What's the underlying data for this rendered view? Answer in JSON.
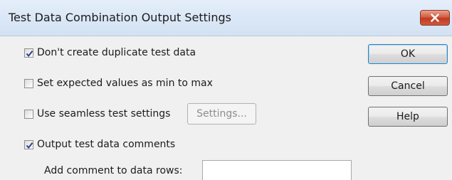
{
  "window": {
    "title": "Test Data Combination Output Settings",
    "close_icon": "close-icon"
  },
  "options": [
    {
      "label": "Don't create duplicate test data",
      "checked": true
    },
    {
      "label": "Set expected values as min to max",
      "checked": false
    },
    {
      "label": "Use seamless test settings",
      "checked": false
    },
    {
      "label": "Output test data comments",
      "checked": true
    }
  ],
  "settings_button": {
    "label": "Settings...",
    "enabled": false
  },
  "buttons": {
    "ok": "OK",
    "cancel": "Cancel",
    "help": "Help"
  },
  "comment_field": {
    "label": "Add comment to data rows:",
    "value": ""
  },
  "colors": {
    "title_bar": "#dbe8f7",
    "dialog_bg": "#f0f0f0",
    "close_button": "#c7472a",
    "default_button_border": "#3c7fb1"
  }
}
